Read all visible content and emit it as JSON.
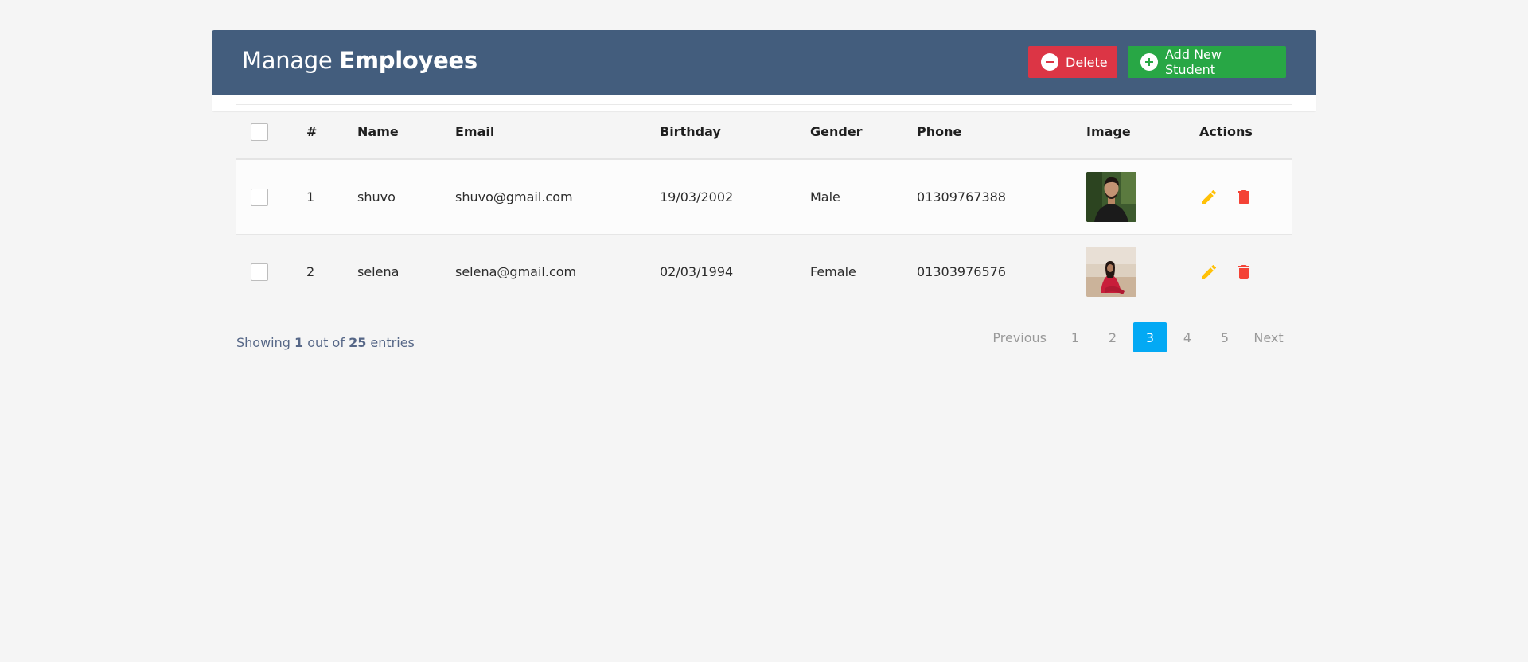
{
  "header": {
    "title_prefix": "Manage",
    "title_bold": "Employees",
    "delete_label": "Delete",
    "add_label": "Add New Student"
  },
  "table": {
    "columns": {
      "num": "#",
      "name": "Name",
      "email": "Email",
      "birthday": "Birthday",
      "gender": "Gender",
      "phone": "Phone",
      "image": "Image",
      "actions": "Actions"
    },
    "rows": [
      {
        "num": "1",
        "name": "shuvo",
        "email": "shuvo@gmail.com",
        "birthday": "19/03/2002",
        "gender": "Male",
        "phone": "01309767388"
      },
      {
        "num": "2",
        "name": "selena",
        "email": "selena@gmail.com",
        "birthday": "02/03/1994",
        "gender": "Female",
        "phone": "01303976576"
      }
    ]
  },
  "footer": {
    "showing_label": "Showing",
    "shown_count": "1",
    "out_of_label": "out of",
    "total_count": "25",
    "entries_label": "entries"
  },
  "pagination": {
    "previous": "Previous",
    "pages": [
      "1",
      "2",
      "3",
      "4",
      "5"
    ],
    "active": "3",
    "next": "Next"
  },
  "colors": {
    "header_bg": "#435d7d",
    "delete": "#dc3545",
    "add": "#28a745",
    "edit_icon": "#ffc107",
    "trash_icon": "#f44336",
    "active_page": "#03a9f4"
  },
  "icons": {
    "delete_button": "minus-circle-icon",
    "add_button": "plus-circle-icon",
    "edit_action": "pencil-icon",
    "delete_action": "trash-icon"
  }
}
